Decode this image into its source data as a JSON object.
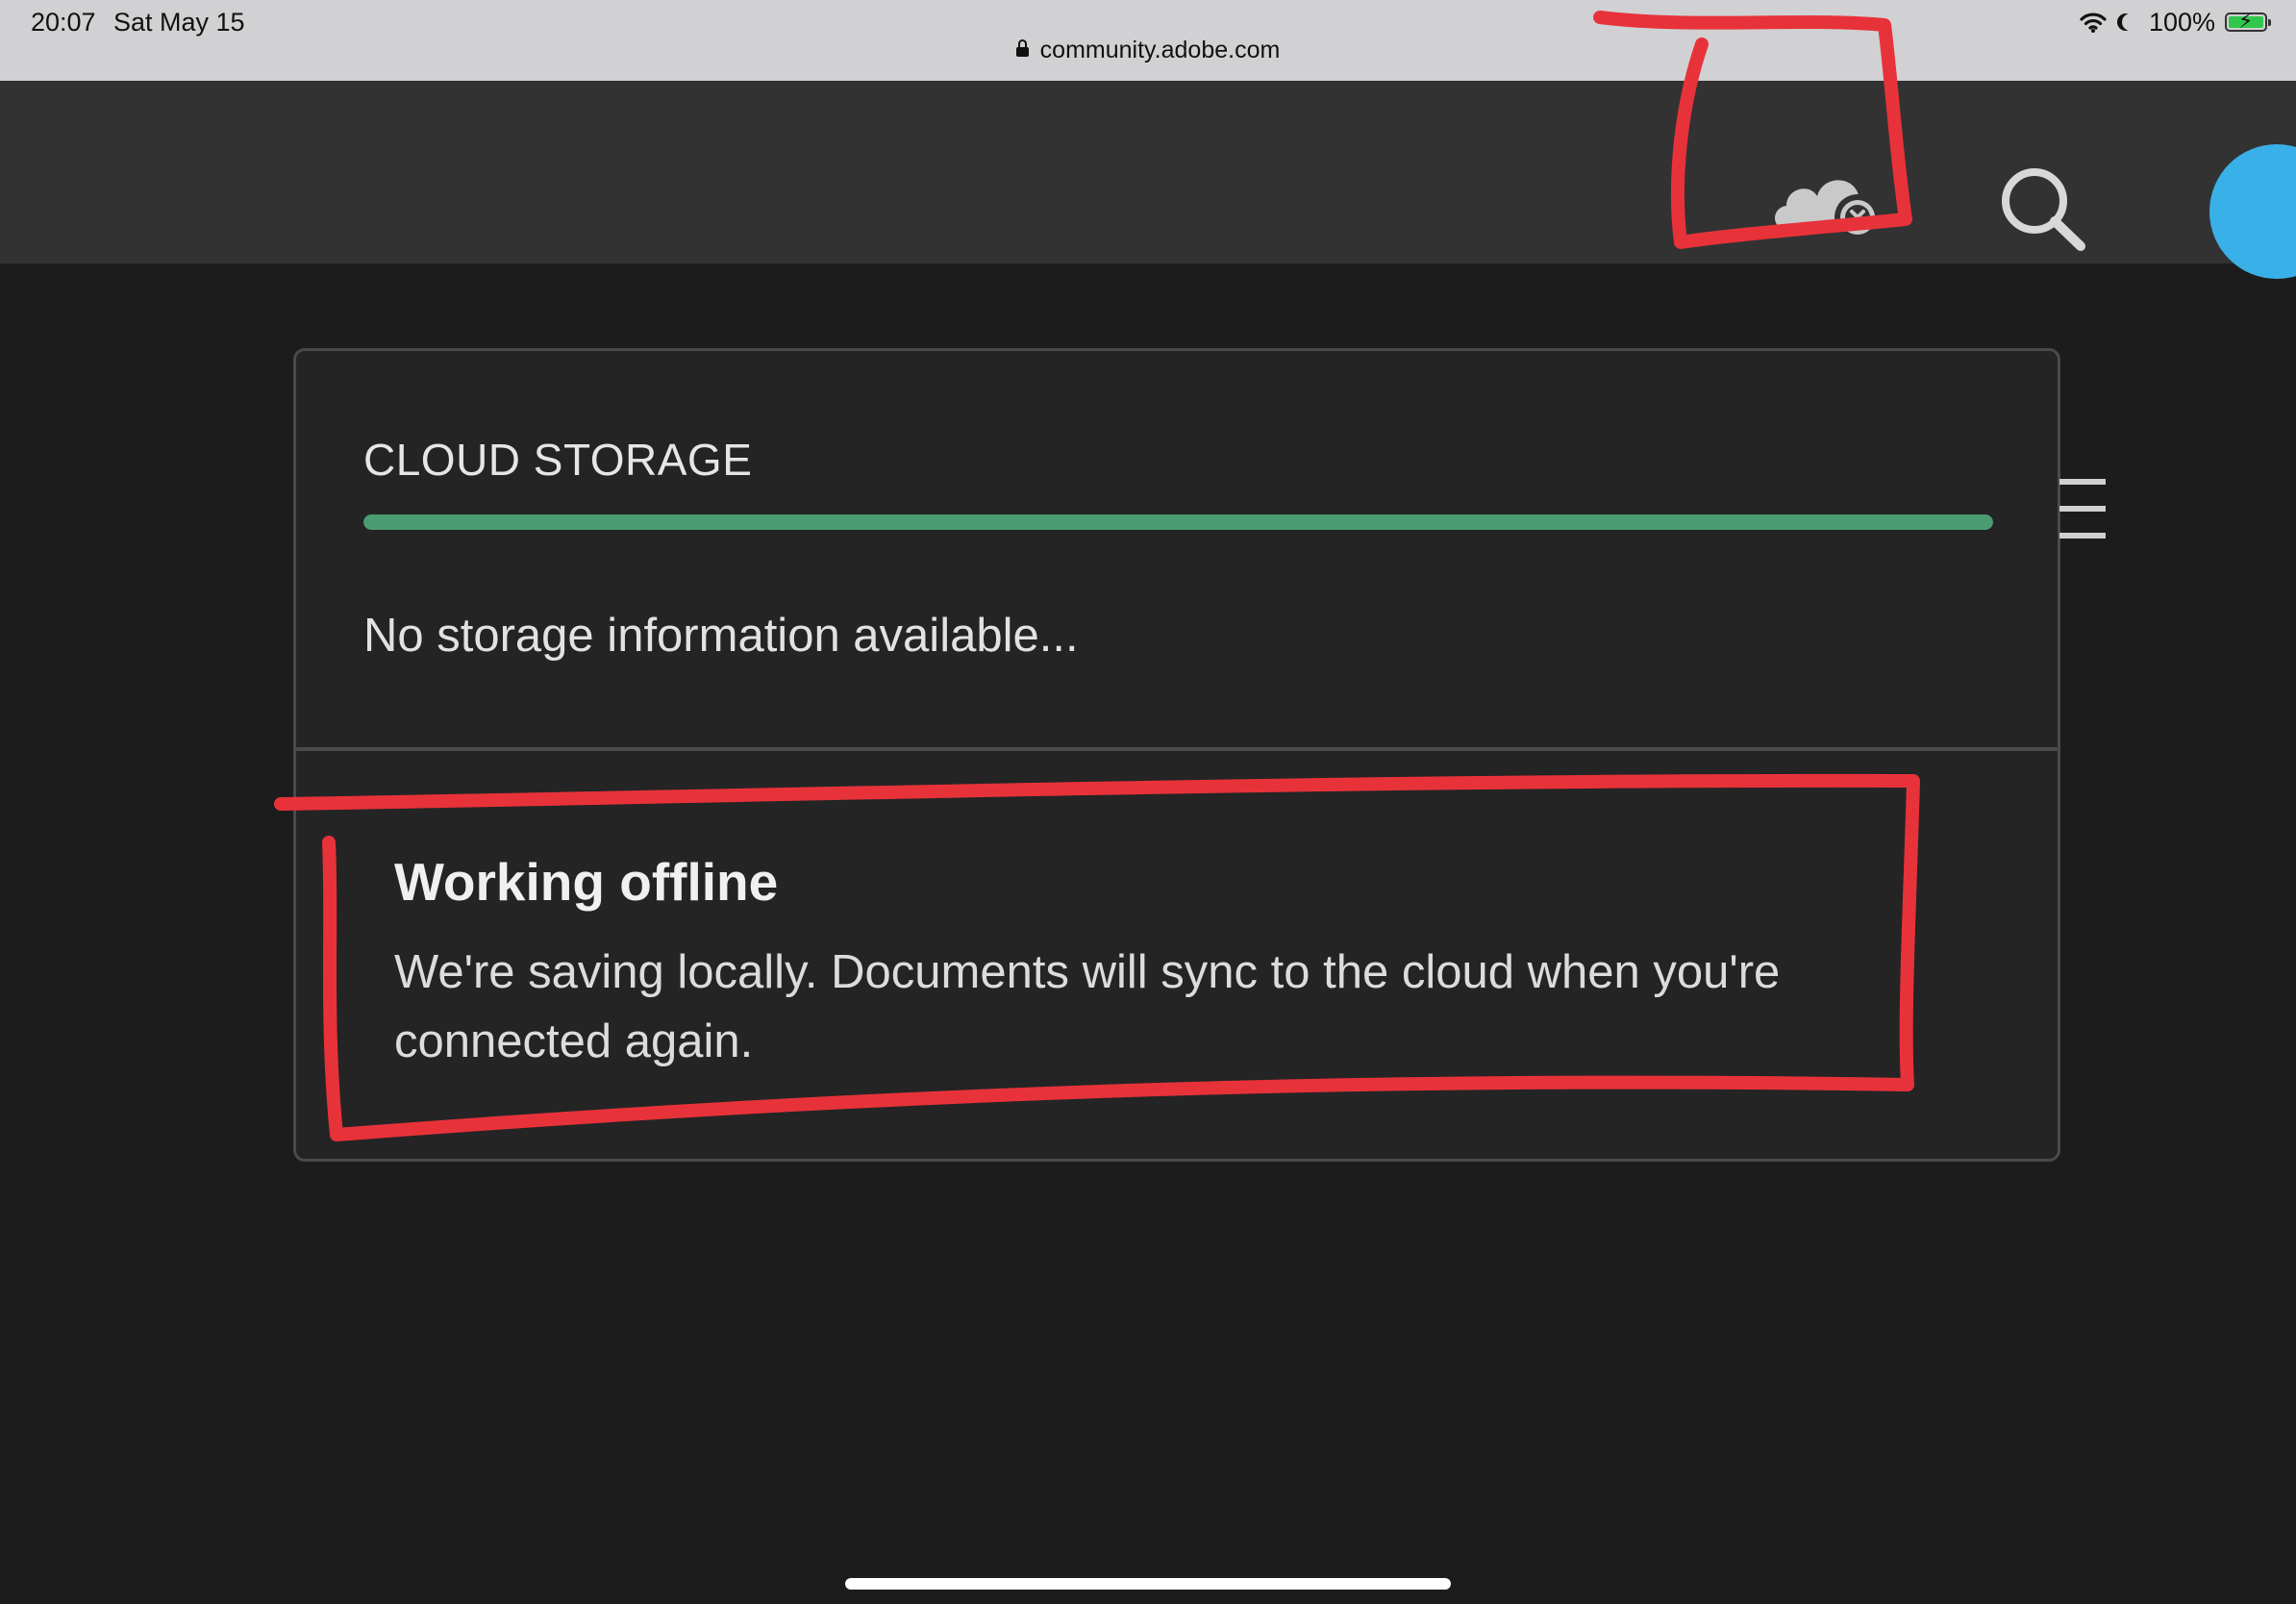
{
  "status_bar": {
    "time": "20:07",
    "date": "Sat May 15",
    "url": "community.adobe.com",
    "battery": "100%"
  },
  "header": {
    "cloud_status_icon": "cloud-offline-icon",
    "search_icon": "search-icon",
    "avatar_color": "#3ab0e8"
  },
  "panel": {
    "title": "CLOUD STORAGE",
    "storage_progress": 1.0,
    "storage_bar_color": "#4b9c73",
    "storage_info": "No storage information available...",
    "offline_title": "Working offline",
    "offline_message": "We're saving locally. Documents will sync to the cloud when you're connected again."
  },
  "annotations": {
    "color": "#e8323a"
  }
}
